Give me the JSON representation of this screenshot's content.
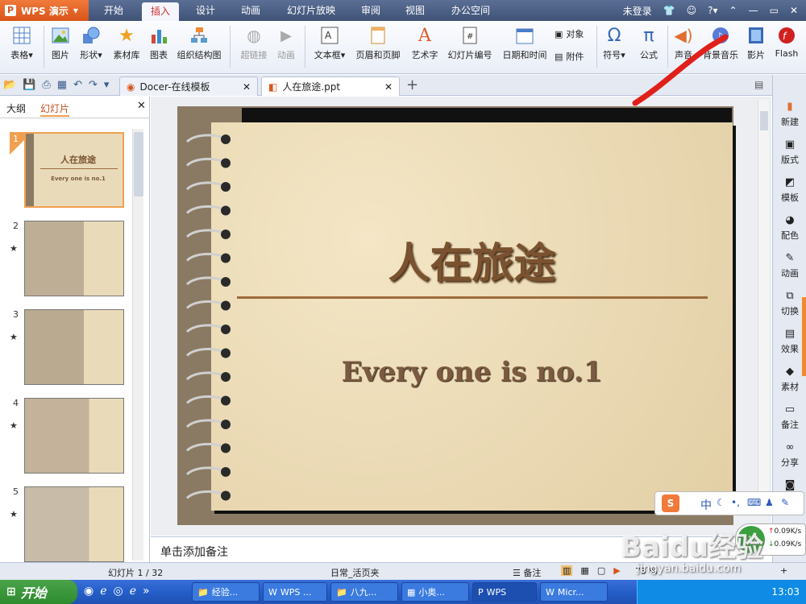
{
  "app": {
    "button_label": "WPS 演示",
    "logo_char": "P"
  },
  "menu": {
    "tabs": [
      "开始",
      "插入",
      "设计",
      "动画",
      "幻灯片放映",
      "审阅",
      "视图",
      "办公空间"
    ],
    "active": "插入"
  },
  "window": {
    "login": "未登录",
    "help": "?"
  },
  "ribbon": {
    "items": [
      "表格",
      "图片",
      "形状",
      "素材库",
      "图表",
      "组织结构图",
      "超链接",
      "动画",
      "文本框",
      "页眉和页脚",
      "艺术字",
      "幻灯片编号",
      "日期和时间",
      "符号",
      "公式",
      "声音",
      "背景音乐",
      "影片",
      "Flash"
    ],
    "small_items": [
      "对象",
      "附件"
    ]
  },
  "doc_tabs": [
    {
      "title": "Docer-在线模板"
    },
    {
      "title": "人在旅途.ppt"
    }
  ],
  "left_pane": {
    "tabs": [
      "大纲",
      "幻灯片"
    ],
    "thumbs": [
      "1",
      "2",
      "3",
      "4",
      "5"
    ],
    "thumb1_title": "人在旅途",
    "thumb1_sub": "Every one is no.1"
  },
  "slide": {
    "title": "人在旅途",
    "subtitle": "Every one is no.1"
  },
  "notes": {
    "placeholder": "单击添加备注"
  },
  "right_sidebar": [
    "新建",
    "版式",
    "模板",
    "配色",
    "动画",
    "切换",
    "效果",
    "素材",
    "备注",
    "分享"
  ],
  "status": {
    "slide_count": "幻灯片 1 / 32",
    "theme": "日常_活页夹",
    "notes_label": "备注",
    "zoom": "73 %"
  },
  "taskbar": {
    "start": "开始",
    "tasks": [
      "经验...",
      "WPS ...",
      "八九...",
      "小奥...",
      "WPS",
      "Micr..."
    ],
    "time": "13:03"
  },
  "network": {
    "up": "0.09K/s",
    "down": "0.09K/s",
    "percent": "61%"
  },
  "ime": {
    "lang": "中"
  },
  "watermark": {
    "brand": "Baidu经验",
    "url": "jingyan.baidu.com"
  },
  "colors": {
    "title_brown": "#7a5230",
    "accent_orange": "#d9541a",
    "highlight_red": "#e0201a"
  }
}
